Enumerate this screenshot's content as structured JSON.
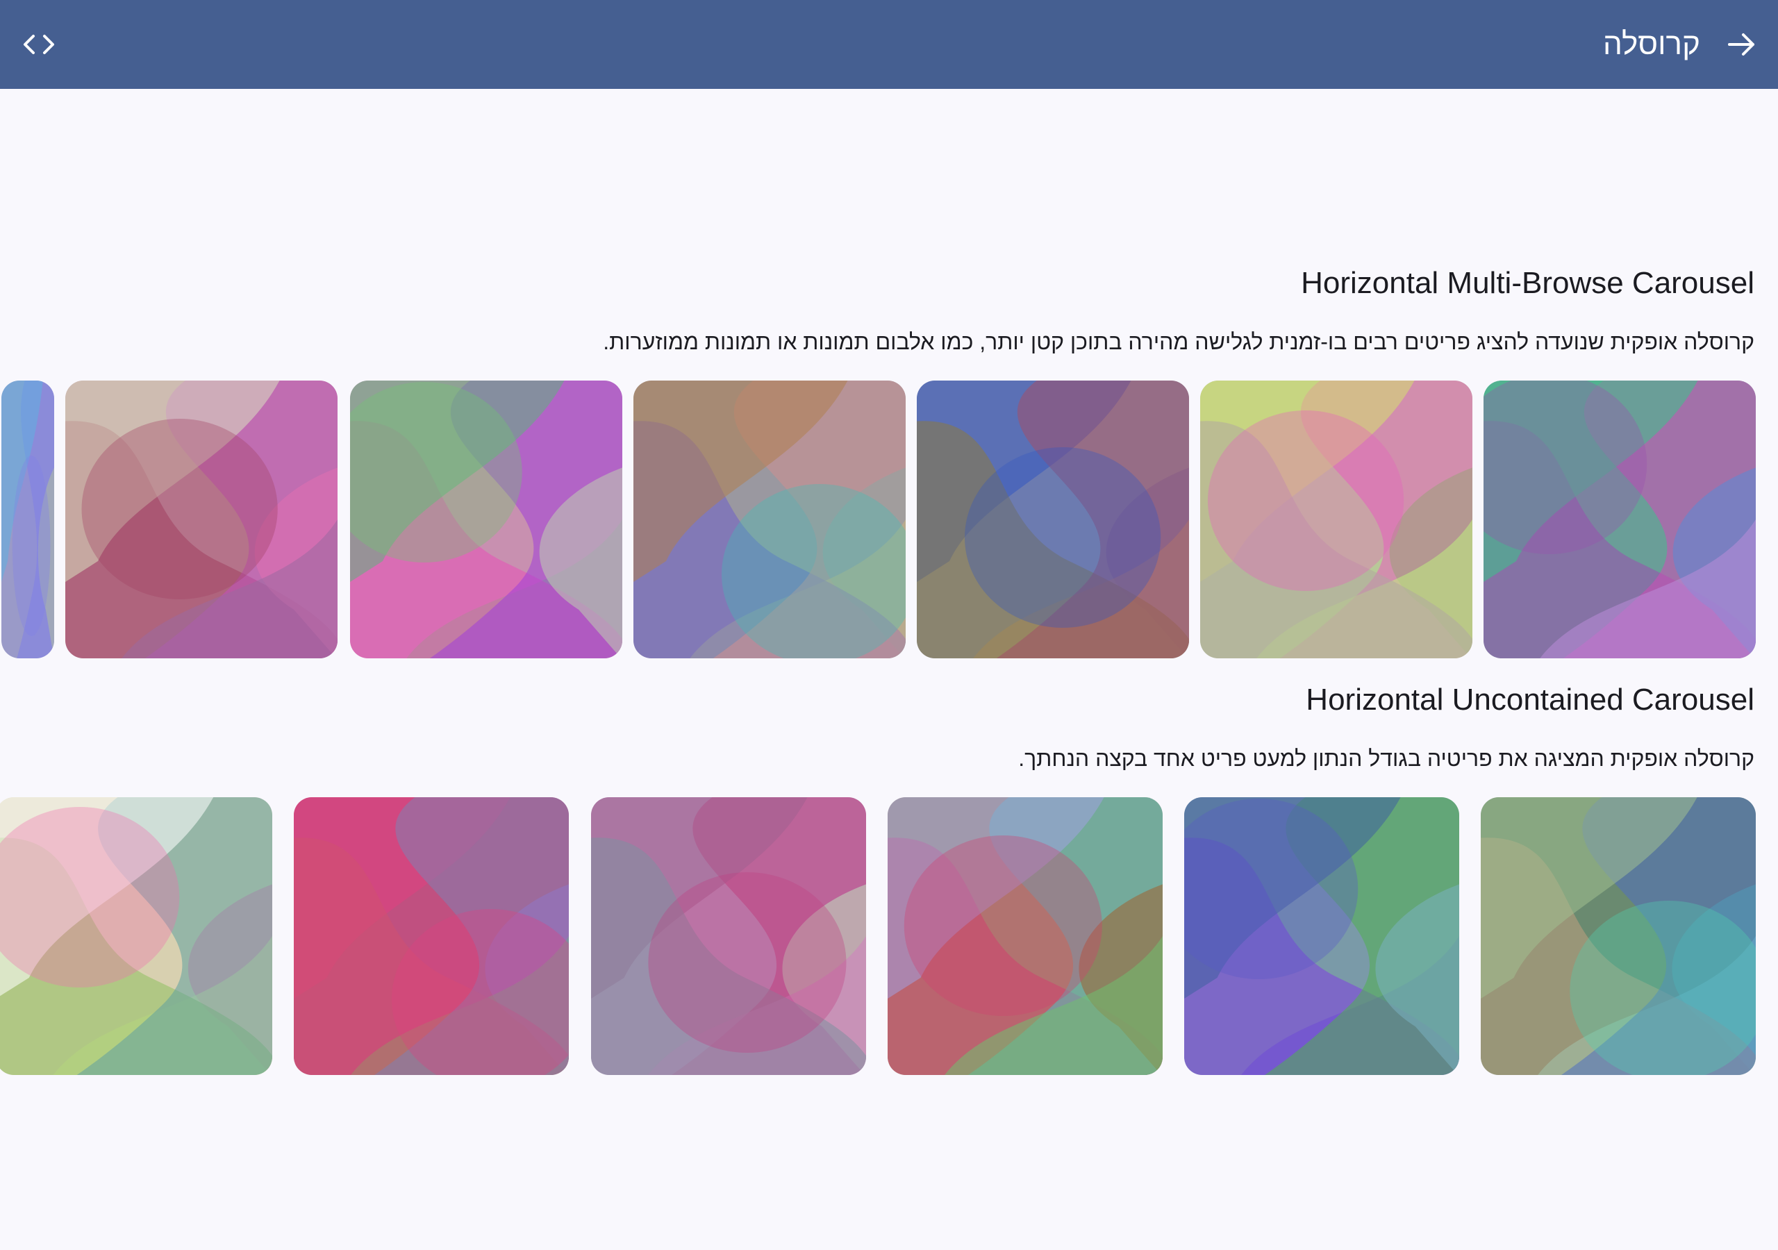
{
  "appbar": {
    "title": "קרוסלה",
    "back_icon": "arrow-forward-icon",
    "code_icon": "code-icon",
    "color": "#455f91"
  },
  "sections": [
    {
      "title": "Horizontal Multi-Browse Carousel",
      "description": "קרוסלה אופקית שנועדה להציג פריטים רבים בו-זמנית לגלישה מהירה בתוכן קטן יותר, כמו אלבום תמונות או תמונות ממוזערות."
    },
    {
      "title": "Horizontal Uncontained Carousel",
      "description": "קרוסלה אופקית המציגה את פריטיה בגודל הנתון למעט פריט אחד בקצה הנחתך."
    }
  ],
  "carousel_multi": [
    {
      "bg": "#6a9e98",
      "c": [
        "#9b4fb0",
        "#d04db8",
        "#3cc28a",
        "#5a8ad6",
        "#b98cd8"
      ]
    },
    {
      "bg": "#b8c898",
      "c": [
        "#e85fc0",
        "#d4e070",
        "#9aa07a",
        "#c0f080",
        "#b0a8a0"
      ]
    },
    {
      "bg": "#8a90a8",
      "c": [
        "#3555c0",
        "#6a6aa8",
        "#c09a70",
        "#8a7a40",
        "#a0506a"
      ]
    },
    {
      "bg": "#9a98a0",
      "c": [
        "#40c0b8",
        "#c8e070",
        "#7060c8",
        "#d09090",
        "#b08050"
      ]
    },
    {
      "bg": "#c890b0",
      "c": [
        "#70c870",
        "#e850b8",
        "#a040d8",
        "#60b080",
        "#c0d0b0"
      ]
    },
    {
      "bg": "#c090a0",
      "c": [
        "#a04060",
        "#c050c0",
        "#d8e0c0",
        "#e070b0",
        "#9a6aa0"
      ]
    },
    {
      "bg": "#9a9ac8",
      "c": [
        "#8080e8",
        "#60b0e0",
        "#b0c0a0"
      ]
    }
  ],
  "carousel_uncontained": [
    {
      "bg": "#6a8a70",
      "c": [
        "#50d0b0",
        "#80f0e0",
        "#c0a080",
        "#5070c0",
        "#a0c090"
      ]
    },
    {
      "bg": "#7a9aa8",
      "c": [
        "#5a5ac8",
        "#8040e0",
        "#50b050",
        "#4060a0",
        "#7ab0c0"
      ]
    },
    {
      "bg": "#a09070",
      "c": [
        "#d04070",
        "#50c0c0",
        "#a0a0e0",
        "#a06030",
        "#70c070"
      ]
    },
    {
      "bg": "#b890b8",
      "c": [
        "#c04080",
        "#a06090",
        "#c0e0c0",
        "#d080c0",
        "#8090a0"
      ]
    },
    {
      "bg": "#c05080",
      "c": [
        "#e04080",
        "#a070e0",
        "#60d060",
        "#d05070",
        "#8080b0"
      ]
    },
    {
      "bg": "#d8d0b0",
      "c": [
        "#f070b0",
        "#e0f0a0",
        "#90c060",
        "#60a0a0",
        "#ffffff"
      ]
    }
  ]
}
